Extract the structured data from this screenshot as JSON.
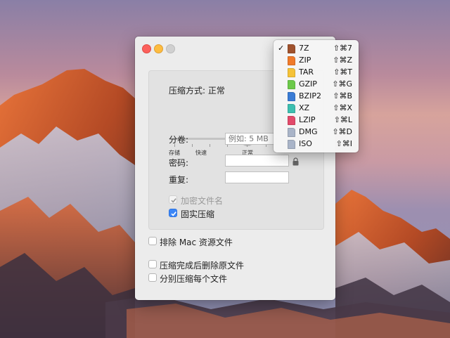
{
  "window": {
    "compression": {
      "title": "压缩方式: 正常",
      "ticks": [
        "存储",
        "快速",
        "正常"
      ]
    },
    "split": {
      "label": "分卷:",
      "placeholder": "例如: 5 MB"
    },
    "password": {
      "label": "密码:",
      "value": ""
    },
    "repeat": {
      "label": "重复:",
      "value": ""
    },
    "encrypt_names": {
      "label": "加密文件名",
      "checked": true,
      "disabled": true
    },
    "solid": {
      "label": "固实压缩",
      "checked": true
    },
    "exclude_mac": {
      "label": "排除 Mac 资源文件",
      "checked": false
    },
    "delete_after": {
      "label": "压缩完成后删除原文件",
      "checked": false
    },
    "separate": {
      "label": "分别压缩每个文件",
      "checked": false
    }
  },
  "format_menu": {
    "items": [
      {
        "label": "7Z",
        "shortcut": "⇧⌘7",
        "checked": true,
        "icon": "7z-file-icon",
        "color": "#a0522d"
      },
      {
        "label": "ZIP",
        "shortcut": "⇧⌘Z",
        "checked": false,
        "icon": "zip-file-icon",
        "color": "#f07a2a"
      },
      {
        "label": "TAR",
        "shortcut": "⇧⌘T",
        "checked": false,
        "icon": "tar-file-icon",
        "color": "#f5c238"
      },
      {
        "label": "GZIP",
        "shortcut": "⇧⌘G",
        "checked": false,
        "icon": "gzip-file-icon",
        "color": "#6cc94a"
      },
      {
        "label": "BZIP2",
        "shortcut": "⇧⌘B",
        "checked": false,
        "icon": "bzip2-file-icon",
        "color": "#3a7bd5"
      },
      {
        "label": "XZ",
        "shortcut": "⇧⌘X",
        "checked": false,
        "icon": "xz-file-icon",
        "color": "#3dbfb0"
      },
      {
        "label": "LZIP",
        "shortcut": "⇧⌘L",
        "checked": false,
        "icon": "lzip-file-icon",
        "color": "#e24a6a"
      },
      {
        "label": "DMG",
        "shortcut": "⇧⌘D",
        "checked": false,
        "icon": "dmg-file-icon",
        "color": "#a9b4c8"
      },
      {
        "label": "ISO",
        "shortcut": "⇧⌘I",
        "checked": false,
        "icon": "iso-file-icon",
        "color": "#a9b4c8"
      }
    ]
  }
}
